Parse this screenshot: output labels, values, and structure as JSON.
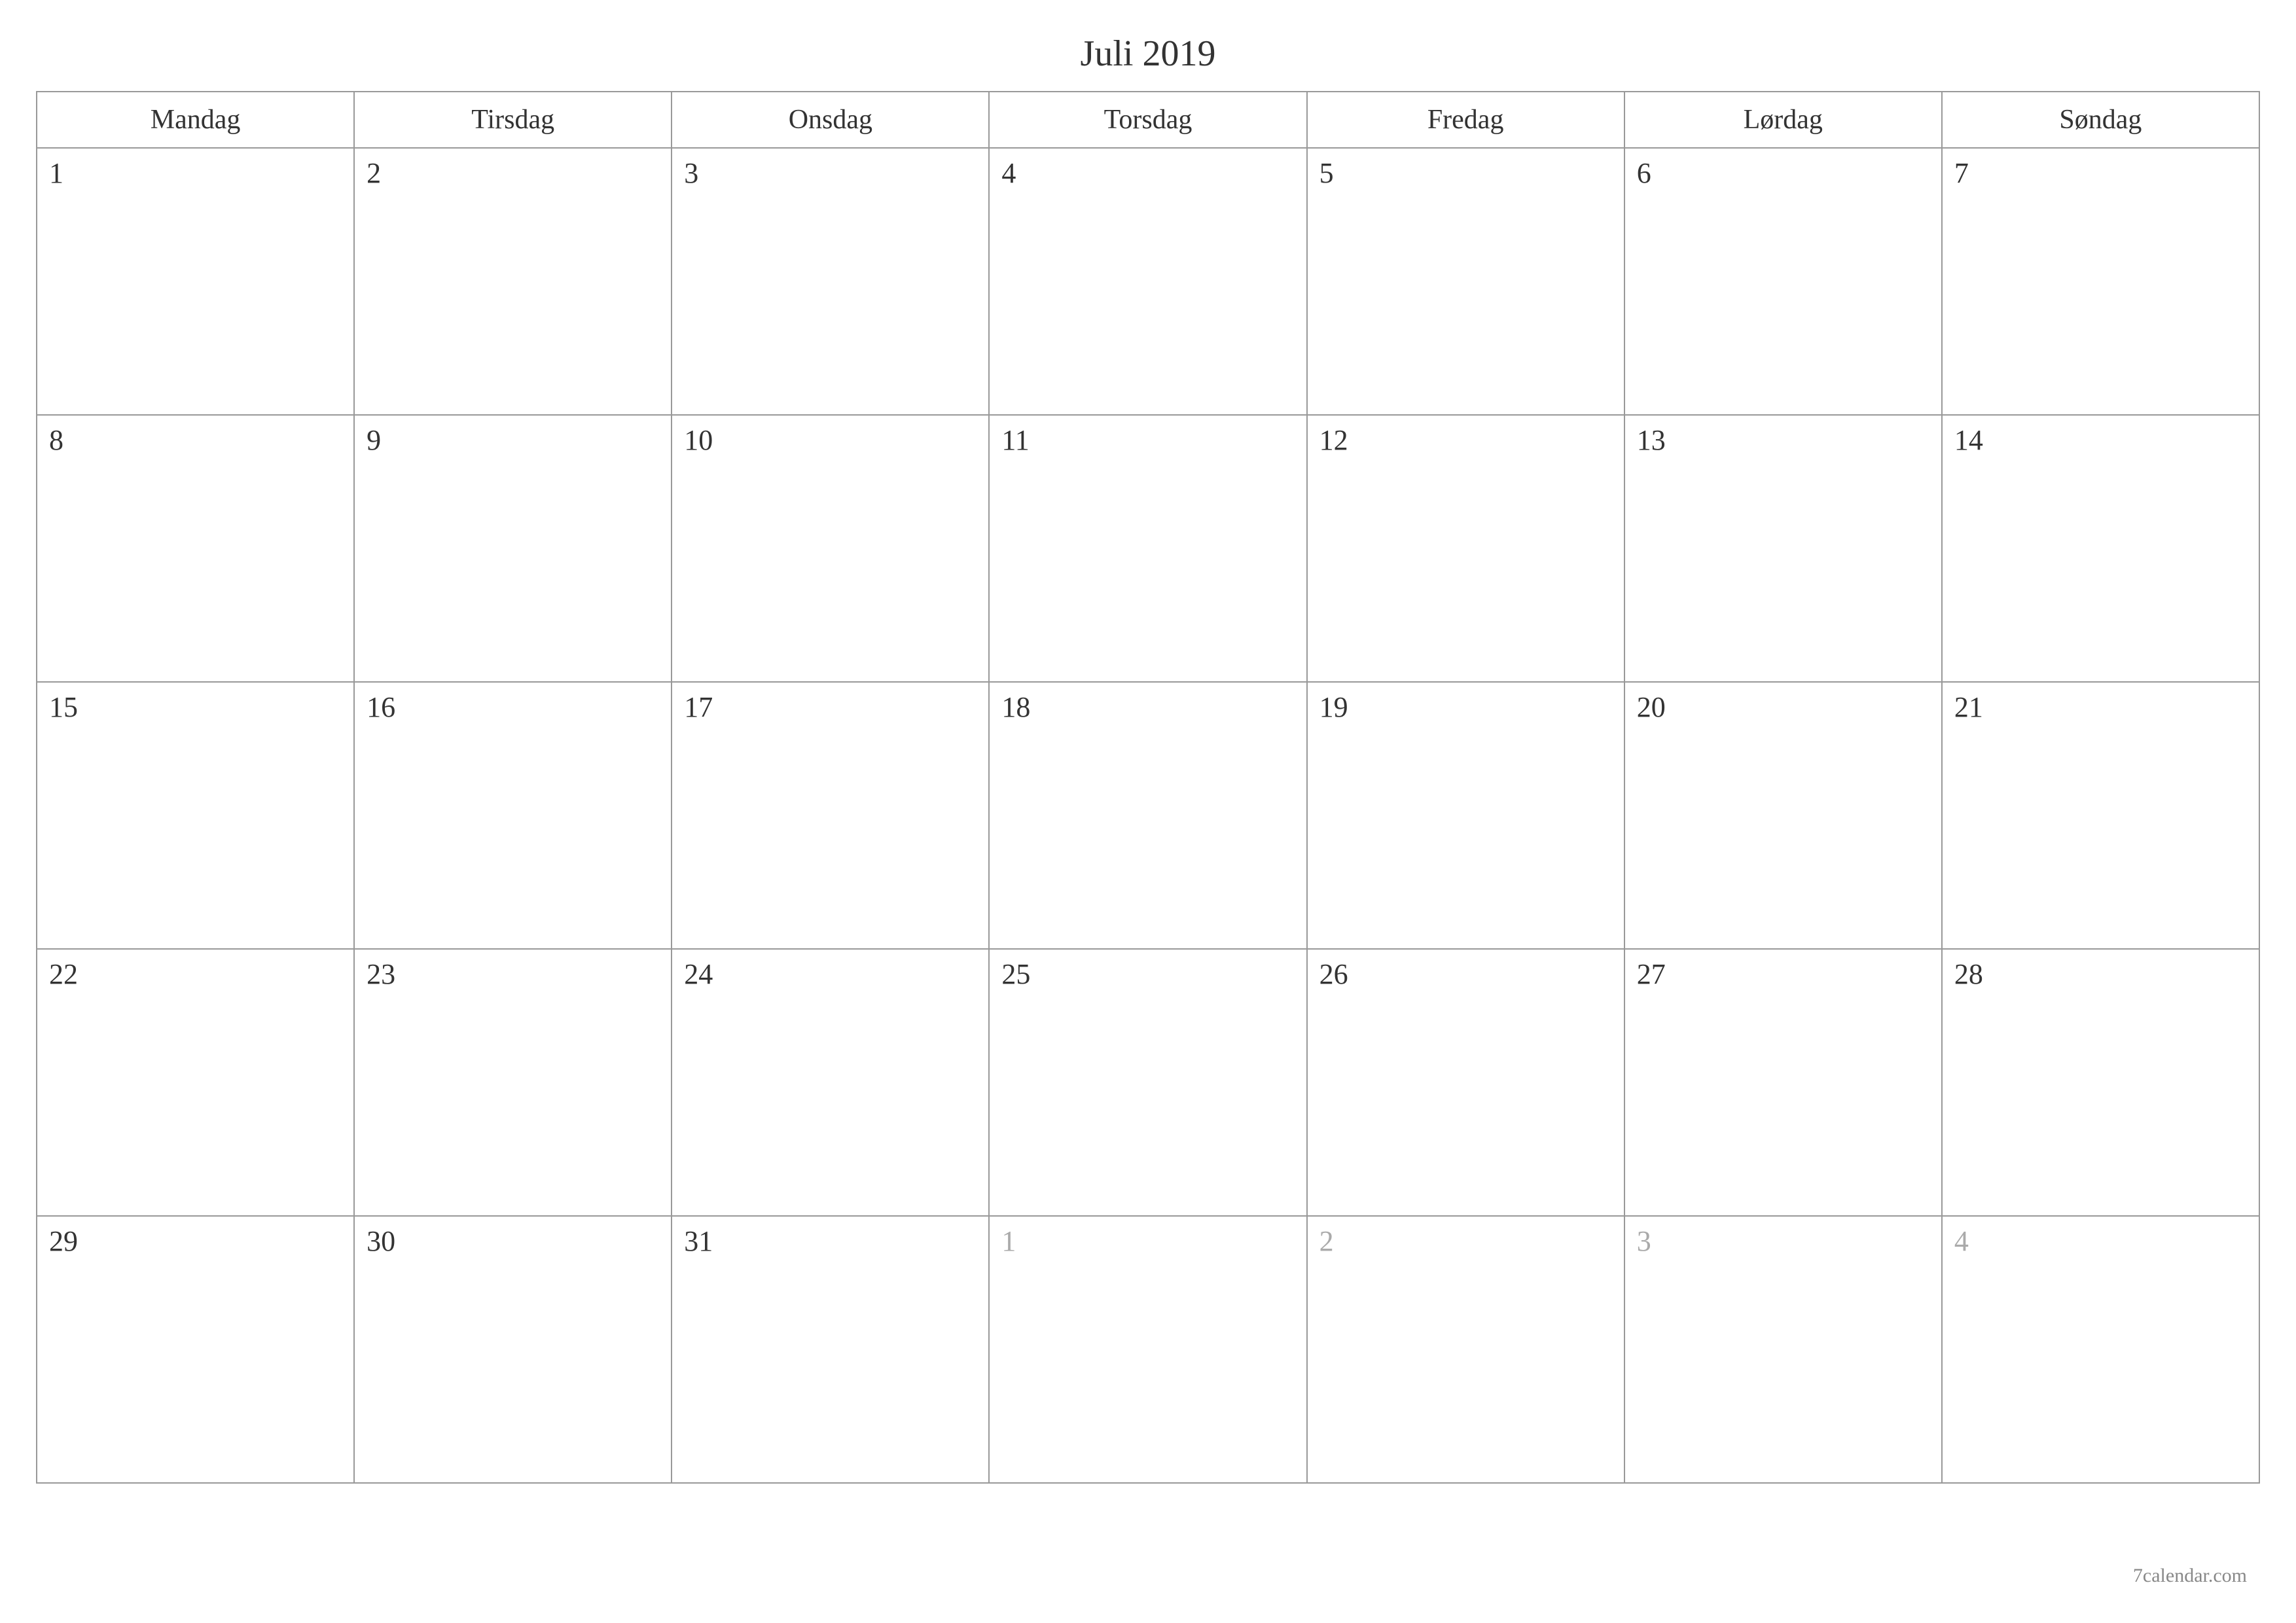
{
  "title": "Juli 2019",
  "weekdays": [
    "Mandag",
    "Tirsdag",
    "Onsdag",
    "Torsdag",
    "Fredag",
    "Lørdag",
    "Søndag"
  ],
  "weeks": [
    [
      {
        "day": "1",
        "other": false
      },
      {
        "day": "2",
        "other": false
      },
      {
        "day": "3",
        "other": false
      },
      {
        "day": "4",
        "other": false
      },
      {
        "day": "5",
        "other": false
      },
      {
        "day": "6",
        "other": false
      },
      {
        "day": "7",
        "other": false
      }
    ],
    [
      {
        "day": "8",
        "other": false
      },
      {
        "day": "9",
        "other": false
      },
      {
        "day": "10",
        "other": false
      },
      {
        "day": "11",
        "other": false
      },
      {
        "day": "12",
        "other": false
      },
      {
        "day": "13",
        "other": false
      },
      {
        "day": "14",
        "other": false
      }
    ],
    [
      {
        "day": "15",
        "other": false
      },
      {
        "day": "16",
        "other": false
      },
      {
        "day": "17",
        "other": false
      },
      {
        "day": "18",
        "other": false
      },
      {
        "day": "19",
        "other": false
      },
      {
        "day": "20",
        "other": false
      },
      {
        "day": "21",
        "other": false
      }
    ],
    [
      {
        "day": "22",
        "other": false
      },
      {
        "day": "23",
        "other": false
      },
      {
        "day": "24",
        "other": false
      },
      {
        "day": "25",
        "other": false
      },
      {
        "day": "26",
        "other": false
      },
      {
        "day": "27",
        "other": false
      },
      {
        "day": "28",
        "other": false
      }
    ],
    [
      {
        "day": "29",
        "other": false
      },
      {
        "day": "30",
        "other": false
      },
      {
        "day": "31",
        "other": false
      },
      {
        "day": "1",
        "other": true
      },
      {
        "day": "2",
        "other": true
      },
      {
        "day": "3",
        "other": true
      },
      {
        "day": "4",
        "other": true
      }
    ]
  ],
  "footer": "7calendar.com"
}
